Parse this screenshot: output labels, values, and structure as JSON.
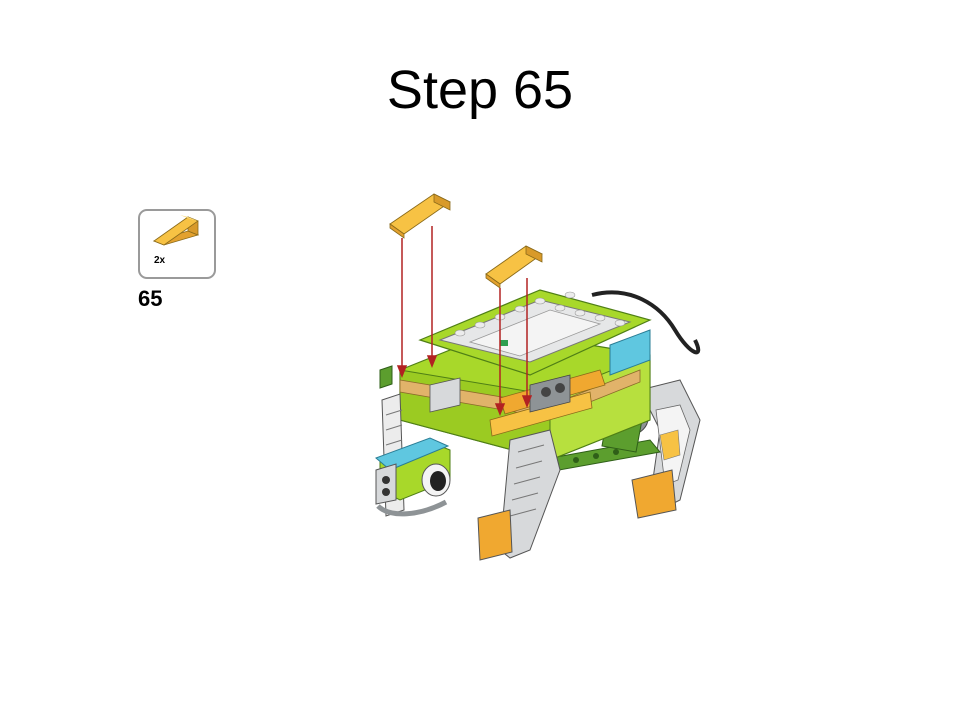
{
  "slide": {
    "title": "Step 65"
  },
  "parts_callout": {
    "part_icon": "slope-brick-icon",
    "count": "2x",
    "part_color": "#F7C244"
  },
  "step": {
    "number": "65"
  },
  "model": {
    "icon": "lego-turtle-model-icon",
    "arrow_color": "#B22222",
    "colors": {
      "lime": "#A8D82A",
      "dark_green": "#5C9E2E",
      "yellow": "#F7C244",
      "orange": "#F0A830",
      "tan": "#E1B36A",
      "light_gray": "#D7D9DB",
      "gray": "#8E9396",
      "white": "#F4F4F4",
      "azure": "#5FC7E0",
      "black": "#222222"
    }
  }
}
